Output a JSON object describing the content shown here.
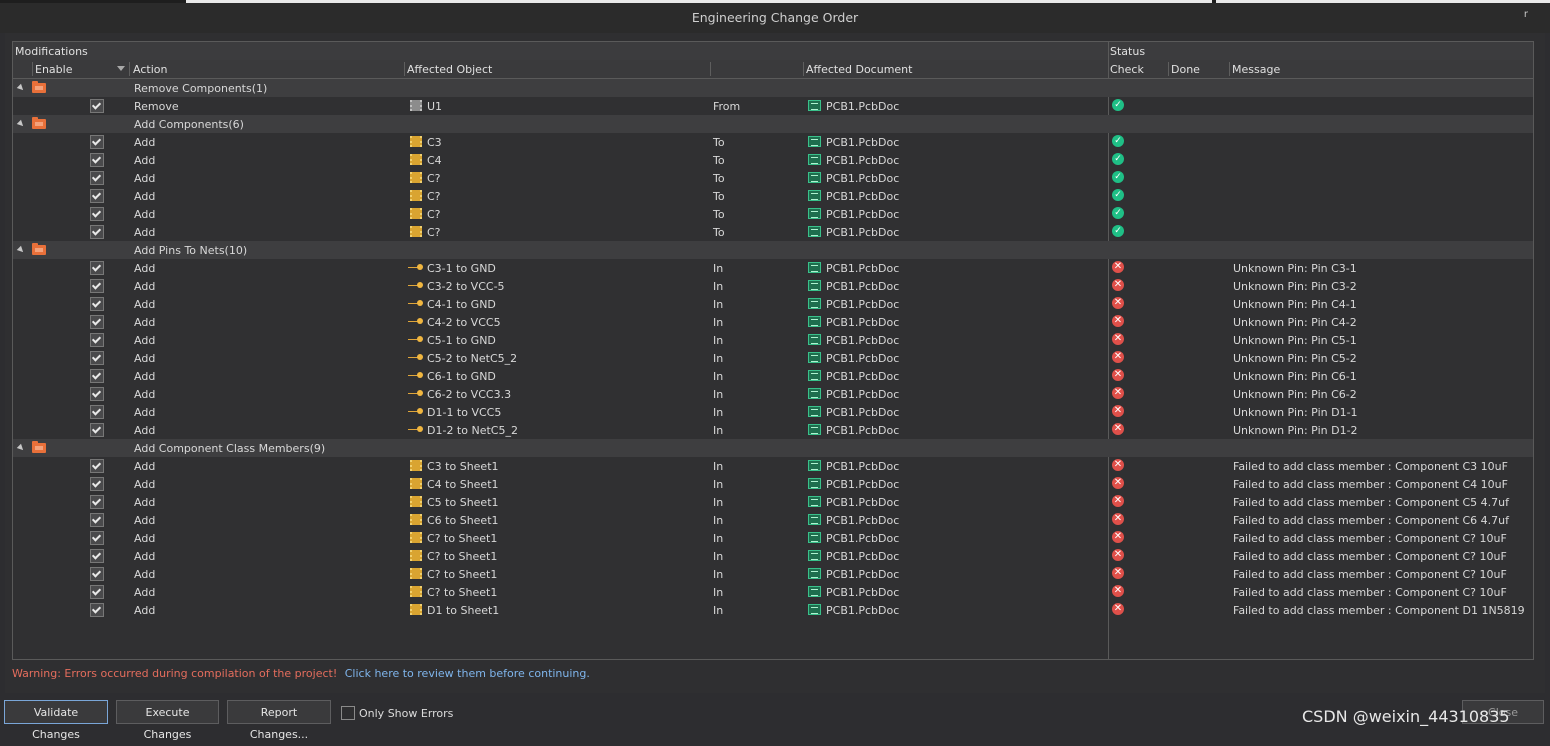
{
  "window": {
    "title": "Engineering Change Order",
    "pin_glyph": "r"
  },
  "grid": {
    "group_headers": {
      "modifications": "Modifications",
      "status": "Status"
    },
    "columns": {
      "enable": "Enable",
      "action": "Action",
      "affected_object": "Affected Object",
      "direction": "",
      "affected_document": "Affected Document",
      "check": "Check",
      "done": "Done",
      "message": "Message"
    }
  },
  "rows": [
    {
      "type": "group",
      "label": "Remove Components(1)"
    },
    {
      "type": "item",
      "enabled": true,
      "action": "Remove",
      "icon": "component-gray-icon",
      "object": "U1",
      "dir": "From",
      "doc": "PCB1.PcbDoc",
      "check": "ok",
      "message": ""
    },
    {
      "type": "group",
      "label": "Add Components(6)"
    },
    {
      "type": "item",
      "enabled": true,
      "action": "Add",
      "icon": "component-icon",
      "object": "C3",
      "dir": "To",
      "doc": "PCB1.PcbDoc",
      "check": "ok",
      "message": ""
    },
    {
      "type": "item",
      "enabled": true,
      "action": "Add",
      "icon": "component-icon",
      "object": "C4",
      "dir": "To",
      "doc": "PCB1.PcbDoc",
      "check": "ok",
      "message": ""
    },
    {
      "type": "item",
      "enabled": true,
      "action": "Add",
      "icon": "component-icon",
      "object": "C?",
      "dir": "To",
      "doc": "PCB1.PcbDoc",
      "check": "ok",
      "message": ""
    },
    {
      "type": "item",
      "enabled": true,
      "action": "Add",
      "icon": "component-icon",
      "object": "C?",
      "dir": "To",
      "doc": "PCB1.PcbDoc",
      "check": "ok",
      "message": ""
    },
    {
      "type": "item",
      "enabled": true,
      "action": "Add",
      "icon": "component-icon",
      "object": "C?",
      "dir": "To",
      "doc": "PCB1.PcbDoc",
      "check": "ok",
      "message": ""
    },
    {
      "type": "item",
      "enabled": true,
      "action": "Add",
      "icon": "component-icon",
      "object": "C?",
      "dir": "To",
      "doc": "PCB1.PcbDoc",
      "check": "ok",
      "message": ""
    },
    {
      "type": "group",
      "label": "Add Pins To Nets(10)"
    },
    {
      "type": "item",
      "enabled": true,
      "action": "Add",
      "icon": "pin-icon",
      "object": "C3-1 to GND",
      "dir": "In",
      "doc": "PCB1.PcbDoc",
      "check": "error",
      "message": "Unknown Pin: Pin C3-1"
    },
    {
      "type": "item",
      "enabled": true,
      "action": "Add",
      "icon": "pin-icon",
      "object": "C3-2 to VCC-5",
      "dir": "In",
      "doc": "PCB1.PcbDoc",
      "check": "error",
      "message": "Unknown Pin: Pin C3-2"
    },
    {
      "type": "item",
      "enabled": true,
      "action": "Add",
      "icon": "pin-icon",
      "object": "C4-1 to GND",
      "dir": "In",
      "doc": "PCB1.PcbDoc",
      "check": "error",
      "message": "Unknown Pin: Pin C4-1"
    },
    {
      "type": "item",
      "enabled": true,
      "action": "Add",
      "icon": "pin-icon",
      "object": "C4-2 to VCC5",
      "dir": "In",
      "doc": "PCB1.PcbDoc",
      "check": "error",
      "message": "Unknown Pin: Pin C4-2"
    },
    {
      "type": "item",
      "enabled": true,
      "action": "Add",
      "icon": "pin-icon",
      "object": "C5-1 to GND",
      "dir": "In",
      "doc": "PCB1.PcbDoc",
      "check": "error",
      "message": "Unknown Pin: Pin C5-1"
    },
    {
      "type": "item",
      "enabled": true,
      "action": "Add",
      "icon": "pin-icon",
      "object": "C5-2 to NetC5_2",
      "dir": "In",
      "doc": "PCB1.PcbDoc",
      "check": "error",
      "message": "Unknown Pin: Pin C5-2"
    },
    {
      "type": "item",
      "enabled": true,
      "action": "Add",
      "icon": "pin-icon",
      "object": "C6-1 to GND",
      "dir": "In",
      "doc": "PCB1.PcbDoc",
      "check": "error",
      "message": "Unknown Pin: Pin C6-1"
    },
    {
      "type": "item",
      "enabled": true,
      "action": "Add",
      "icon": "pin-icon",
      "object": "C6-2 to VCC3.3",
      "dir": "In",
      "doc": "PCB1.PcbDoc",
      "check": "error",
      "message": "Unknown Pin: Pin C6-2"
    },
    {
      "type": "item",
      "enabled": true,
      "action": "Add",
      "icon": "pin-icon",
      "object": "D1-1 to VCC5",
      "dir": "In",
      "doc": "PCB1.PcbDoc",
      "check": "error",
      "message": "Unknown Pin: Pin D1-1"
    },
    {
      "type": "item",
      "enabled": true,
      "action": "Add",
      "icon": "pin-icon",
      "object": "D1-2 to NetC5_2",
      "dir": "In",
      "doc": "PCB1.PcbDoc",
      "check": "error",
      "message": "Unknown Pin: Pin D1-2"
    },
    {
      "type": "group",
      "label": "Add Component Class Members(9)"
    },
    {
      "type": "item",
      "enabled": true,
      "action": "Add",
      "icon": "component-icon",
      "object": "C3 to Sheet1",
      "dir": "In",
      "doc": "PCB1.PcbDoc",
      "check": "error",
      "message": "Failed to add class member : Component C3 10uF"
    },
    {
      "type": "item",
      "enabled": true,
      "action": "Add",
      "icon": "component-icon",
      "object": "C4 to Sheet1",
      "dir": "In",
      "doc": "PCB1.PcbDoc",
      "check": "error",
      "message": "Failed to add class member : Component C4 10uF"
    },
    {
      "type": "item",
      "enabled": true,
      "action": "Add",
      "icon": "component-icon",
      "object": "C5 to Sheet1",
      "dir": "In",
      "doc": "PCB1.PcbDoc",
      "check": "error",
      "message": "Failed to add class member : Component C5 4.7uf"
    },
    {
      "type": "item",
      "enabled": true,
      "action": "Add",
      "icon": "component-icon",
      "object": "C6 to Sheet1",
      "dir": "In",
      "doc": "PCB1.PcbDoc",
      "check": "error",
      "message": "Failed to add class member : Component C6 4.7uf"
    },
    {
      "type": "item",
      "enabled": true,
      "action": "Add",
      "icon": "component-icon",
      "object": "C? to Sheet1",
      "dir": "In",
      "doc": "PCB1.PcbDoc",
      "check": "error",
      "message": "Failed to add class member : Component C? 10uF"
    },
    {
      "type": "item",
      "enabled": true,
      "action": "Add",
      "icon": "component-icon",
      "object": "C? to Sheet1",
      "dir": "In",
      "doc": "PCB1.PcbDoc",
      "check": "error",
      "message": "Failed to add class member : Component C? 10uF"
    },
    {
      "type": "item",
      "enabled": true,
      "action": "Add",
      "icon": "component-icon",
      "object": "C? to Sheet1",
      "dir": "In",
      "doc": "PCB1.PcbDoc",
      "check": "error",
      "message": "Failed to add class member : Component C? 10uF"
    },
    {
      "type": "item",
      "enabled": true,
      "action": "Add",
      "icon": "component-icon",
      "object": "C? to Sheet1",
      "dir": "In",
      "doc": "PCB1.PcbDoc",
      "check": "error",
      "message": "Failed to add class member : Component C? 10uF"
    },
    {
      "type": "item",
      "enabled": true,
      "action": "Add",
      "icon": "component-icon",
      "object": "D1 to Sheet1",
      "dir": "In",
      "doc": "PCB1.PcbDoc",
      "check": "error",
      "message": "Failed to add class member : Component D1 1N5819"
    }
  ],
  "footer": {
    "warning": "Warning: Errors occurred during compilation of the project!",
    "review_link": "Click here to review them before continuing."
  },
  "buttons": {
    "validate": "Validate Changes",
    "execute": "Execute Changes",
    "report": "Report Changes...",
    "only_errors": "Only Show Errors",
    "close": "Close"
  },
  "watermark": "CSDN @weixin_44310835",
  "colors": {
    "ok": "#1fbf86",
    "error": "#e0504a",
    "warning": "#e46d5d",
    "link": "#7fb5ec"
  }
}
